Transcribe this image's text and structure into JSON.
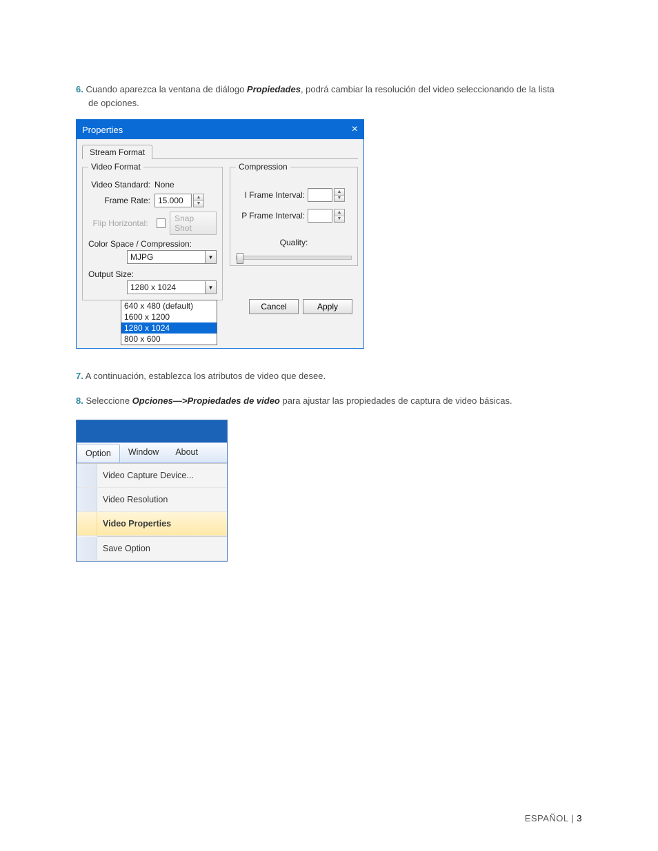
{
  "para6": {
    "num": "6.",
    "pre": " Cuando aparezca la ventana de diálogo ",
    "bold": "Propiedades",
    "post": ", podrá cambiar la resolución del video seleccionando de la lista",
    "cont": "de opciones."
  },
  "dlg": {
    "title": "Properties",
    "close": "×",
    "tab": "Stream Format",
    "videoFormat": {
      "legend": "Video Format",
      "videoStandardLabel": "Video Standard:",
      "videoStandardValue": "None",
      "frameRateLabel": "Frame Rate:",
      "frameRateValue": "15.000",
      "flipLabel": "Flip Horizontal:",
      "snap": "Snap Shot",
      "colorSpaceLabel": "Color Space / Compression:",
      "colorSpaceValue": "MJPG",
      "outputSizeLabel": "Output Size:",
      "outputSizeValue": "1280 x 1024",
      "options": {
        "o1": "640 x 480  (default)",
        "o2": "1600 x 1200",
        "o3": "1280 x 1024",
        "o4": "800 x 600"
      }
    },
    "compression": {
      "legend": "Compression",
      "iFrame": "I Frame Interval:",
      "pFrame": "P Frame Interval:",
      "quality": "Quality:"
    },
    "actions": {
      "cancel": "Cancel",
      "apply": "Apply"
    }
  },
  "para7": {
    "num": "7.",
    "text": " A continuación, establezca los atributos de video que desee."
  },
  "para8": {
    "num": "8.",
    "pre": " Seleccione ",
    "bold": "Opciones—>Propiedades de video",
    "post": " para ajustar las propiedades de captura de video básicas."
  },
  "menu": {
    "option": "Option",
    "window": "Window",
    "about": "About",
    "items": {
      "vcd": "Video Capture Device...",
      "vres": "Video Resolution",
      "vprop": "Video Properties",
      "save": "Save Option"
    }
  },
  "footer": {
    "lang": "ESPAÑOL",
    "sep": " | ",
    "page": "3"
  }
}
